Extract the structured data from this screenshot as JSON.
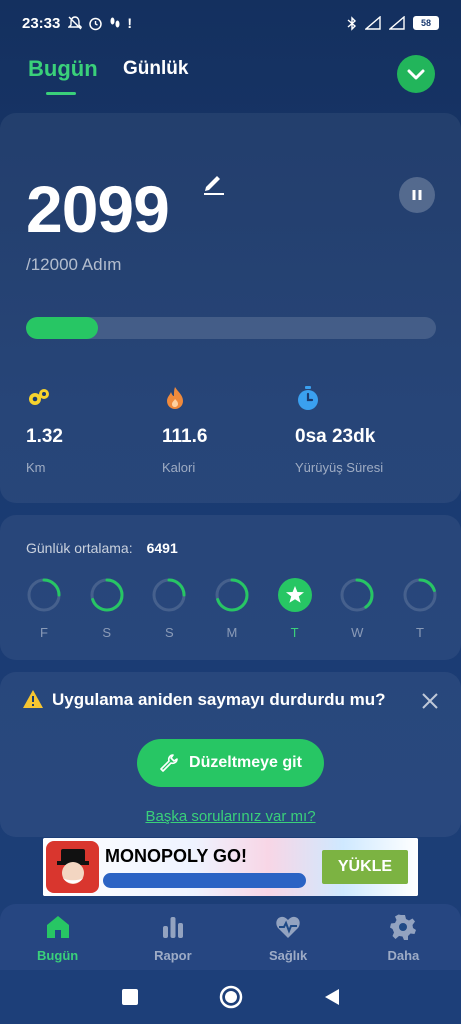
{
  "status_bar": {
    "time": "23:33",
    "battery": "58",
    "icons_left": [
      "mute-icon",
      "alarm-icon",
      "steps-icon",
      "exclamation-icon"
    ],
    "icons_right": [
      "bluetooth-icon",
      "signal-icon",
      "signal-icon",
      "battery-icon"
    ]
  },
  "header": {
    "tab_today": "Bugün",
    "tab_daily": "Günlük",
    "check_icon": "check-chevron-icon"
  },
  "main": {
    "steps": "2099",
    "goal": "/12000 Adım",
    "progress_fraction": 0.175,
    "stats": [
      {
        "icon": "distance-icon",
        "value": "1.32",
        "label": "Km",
        "color": "#f6d32d"
      },
      {
        "icon": "flame-icon",
        "value": "111.6",
        "label": "Kalori",
        "color": "#f08a3c"
      },
      {
        "icon": "timer-icon",
        "value": "0sa 23dk",
        "label": "Yürüyüş Süresi",
        "color": "#3aa0f0"
      }
    ]
  },
  "week": {
    "avg_label": "Günlük ortalama:",
    "avg_value": "6491",
    "days": [
      {
        "letter": "F",
        "progress": 0.25,
        "active": false
      },
      {
        "letter": "S",
        "progress": 0.7,
        "active": false
      },
      {
        "letter": "S",
        "progress": 0.25,
        "active": false
      },
      {
        "letter": "M",
        "progress": 0.7,
        "active": false
      },
      {
        "letter": "T",
        "progress": 1.0,
        "active": true
      },
      {
        "letter": "W",
        "progress": 0.4,
        "active": false
      },
      {
        "letter": "T",
        "progress": 0.2,
        "active": false
      }
    ]
  },
  "question": {
    "title": "Uygulama aniden saymayı durdurdu mu?",
    "button": "Düzeltmeye git",
    "link": "Başka sorularınız var mı?"
  },
  "ad": {
    "title": "MONOPOLY GO!",
    "button": "YÜKLE"
  },
  "bottom_nav": [
    {
      "label": "Bugün",
      "icon": "home-icon",
      "active": true
    },
    {
      "label": "Rapor",
      "icon": "bar-chart-icon",
      "active": false
    },
    {
      "label": "Sağlık",
      "icon": "heart-pulse-icon",
      "active": false
    },
    {
      "label": "Daha",
      "icon": "gear-icon",
      "active": false
    }
  ],
  "colors": {
    "accent": "#27c664",
    "background": "#1a3a70"
  }
}
